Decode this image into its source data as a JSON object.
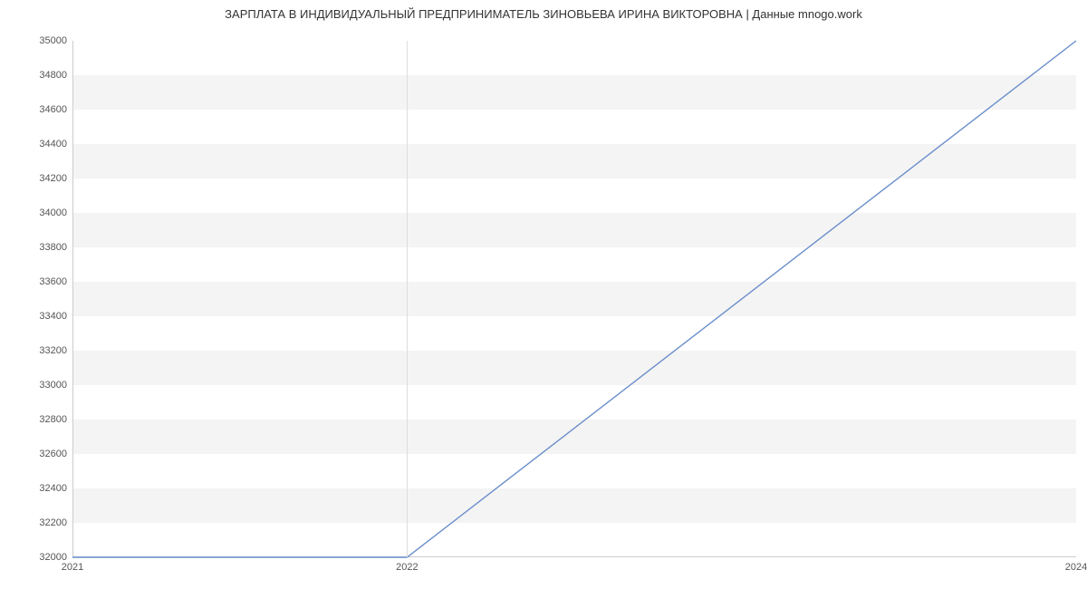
{
  "chart_data": {
    "type": "line",
    "title": "ЗАРПЛАТА В ИНДИВИДУАЛЬНЫЙ ПРЕДПРИНИМАТЕЛЬ ЗИНОВЬЕВА ИРИНА ВИКТОРОВНА | Данные mnogo.work",
    "xlabel": "",
    "ylabel": "",
    "x": [
      2021,
      2022,
      2024
    ],
    "values": [
      32000,
      32000,
      35000
    ],
    "y_ticks": [
      32000,
      32200,
      32400,
      32600,
      32800,
      33000,
      33200,
      33400,
      33600,
      33800,
      34000,
      34200,
      34400,
      34600,
      34800,
      35000
    ],
    "x_ticks": [
      2021,
      2022,
      2024
    ],
    "xlim": [
      2021,
      2024
    ],
    "ylim": [
      32000,
      35000
    ],
    "line_color": "#6a8ecb",
    "band_color": "#f4f4f4"
  }
}
